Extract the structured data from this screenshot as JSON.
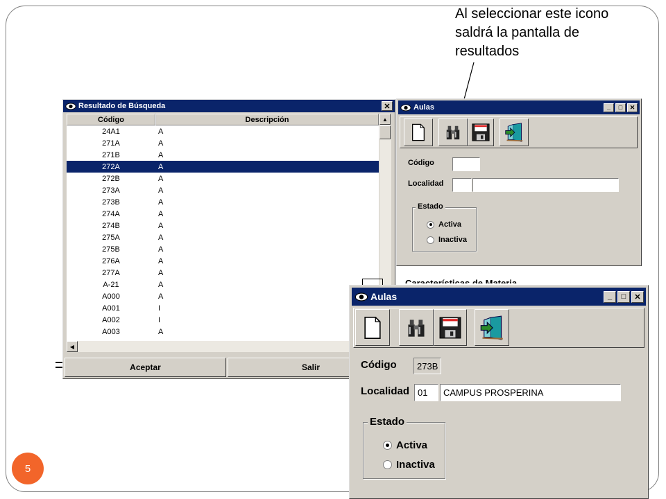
{
  "slide": {
    "callout": "Al seleccionar este icono saldrá la pantalla de resultados",
    "page_number": "5",
    "badge_color": "#f2652a"
  },
  "search_window": {
    "title": "Resultado de Búsqueda",
    "columns": [
      "Código",
      "Descripción"
    ],
    "rows": [
      {
        "code": "24A1",
        "desc": "A"
      },
      {
        "code": "271A",
        "desc": "A"
      },
      {
        "code": "271B",
        "desc": "A"
      },
      {
        "code": "272A",
        "desc": "A",
        "selected": true
      },
      {
        "code": "272B",
        "desc": "A"
      },
      {
        "code": "273A",
        "desc": "A"
      },
      {
        "code": "273B",
        "desc": "A"
      },
      {
        "code": "274A",
        "desc": "A"
      },
      {
        "code": "274B",
        "desc": "A"
      },
      {
        "code": "275A",
        "desc": "A"
      },
      {
        "code": "275B",
        "desc": "A"
      },
      {
        "code": "276A",
        "desc": "A"
      },
      {
        "code": "277A",
        "desc": "A"
      },
      {
        "code": "A-21",
        "desc": "A"
      },
      {
        "code": "A000",
        "desc": "A"
      },
      {
        "code": "A001",
        "desc": "I"
      },
      {
        "code": "A002",
        "desc": "I"
      },
      {
        "code": "A003",
        "desc": "A"
      }
    ],
    "accept_label": "Aceptar",
    "exit_label": "Salir"
  },
  "aulas_small": {
    "title": "Aulas",
    "codigo_label": "Código",
    "codigo_value": "",
    "localidad_label": "Localidad",
    "estado_label": "Estado",
    "activa_label": "Activa",
    "inactiva_label": "Inactiva",
    "behind_text": "Características de Materia"
  },
  "aulas_large": {
    "title": "Aulas",
    "codigo_label": "Código",
    "codigo_value": "273B",
    "localidad_label": "Localidad",
    "localidad_code": "01",
    "localidad_name": "CAMPUS PROSPERINA",
    "estado_label": "Estado",
    "activa_label": "Activa",
    "inactiva_label": "Inactiva",
    "selected_estado": "Activa"
  },
  "icons": [
    "eye-icon",
    "new-document-icon",
    "binoculars-icon",
    "save-disk-icon",
    "exit-door-icon"
  ],
  "colors": {
    "titlebar": "#0a246a",
    "window": "#d4d0c8",
    "selection": "#0a246a"
  }
}
